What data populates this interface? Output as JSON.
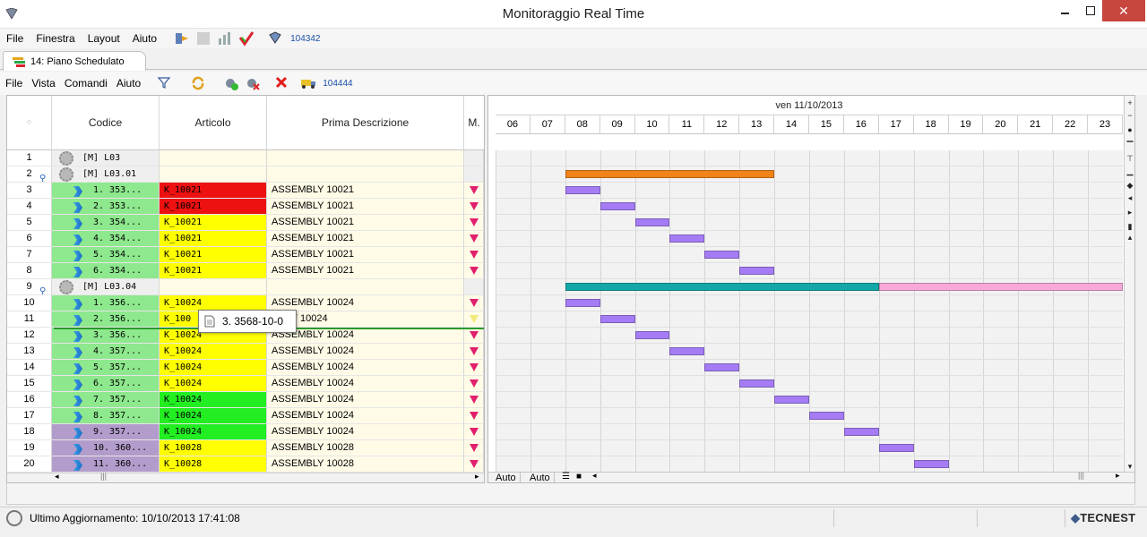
{
  "window": {
    "title": "Monitoraggio Real Time"
  },
  "main_menu": {
    "items": [
      "File",
      "Finestra",
      "Layout",
      "Aiuto"
    ],
    "counter": "104342"
  },
  "doc_tab": {
    "label": "14: Piano Schedulato"
  },
  "inner_menu": {
    "items": [
      "File",
      "Vista",
      "Comandi",
      "Aiuto"
    ],
    "counter": "104444"
  },
  "grid": {
    "headers": {
      "codice": "Codice",
      "articolo": "Articolo",
      "descrizione": "Prima Descrizione",
      "m": "M."
    },
    "rows": [
      {
        "n": "1",
        "kind": "group",
        "code": "[M] L03",
        "pin": false,
        "art": "",
        "desc": "",
        "m": ""
      },
      {
        "n": "2",
        "kind": "group",
        "code": "[M] L03.01",
        "pin": true,
        "art": "",
        "desc": "",
        "m": ""
      },
      {
        "n": "3",
        "kind": "item",
        "code": "1. 353...",
        "chip": "#8ee88e",
        "art": "K_10021",
        "art_color": "#ee1111",
        "desc": "ASSEMBLY 10021",
        "m": "down"
      },
      {
        "n": "4",
        "kind": "item",
        "code": "2. 353...",
        "chip": "#8ee88e",
        "art": "K_10021",
        "art_color": "#ee1111",
        "desc": "ASSEMBLY 10021",
        "m": "down"
      },
      {
        "n": "5",
        "kind": "item",
        "code": "3. 354...",
        "chip": "#8ee88e",
        "art": "K_10021",
        "art_color": "#ffff00",
        "desc": "ASSEMBLY 10021",
        "m": "down"
      },
      {
        "n": "6",
        "kind": "item",
        "code": "4. 354...",
        "chip": "#8ee88e",
        "art": "K_10021",
        "art_color": "#ffff00",
        "desc": "ASSEMBLY 10021",
        "m": "down"
      },
      {
        "n": "7",
        "kind": "item",
        "code": "5. 354...",
        "chip": "#8ee88e",
        "art": "K_10021",
        "art_color": "#ffff00",
        "desc": "ASSEMBLY 10021",
        "m": "down"
      },
      {
        "n": "8",
        "kind": "item",
        "code": "6. 354...",
        "chip": "#8ee88e",
        "art": "K_10021",
        "art_color": "#ffff00",
        "desc": "ASSEMBLY 10021",
        "m": "down"
      },
      {
        "n": "9",
        "kind": "group",
        "code": "[M] L03.04",
        "pin": true,
        "art": "",
        "desc": "",
        "m": ""
      },
      {
        "n": "10",
        "kind": "item",
        "code": "1. 356...",
        "chip": "#8ee88e",
        "art": "K_10024",
        "art_color": "#ffff00",
        "desc": "ASSEMBLY 10024",
        "m": "down"
      },
      {
        "n": "11",
        "kind": "item",
        "code": "2. 356...",
        "chip": "#8ee88e",
        "art": "K_100",
        "art_color": "#ffff00",
        "desc": "MBLY 10024",
        "m": "light"
      },
      {
        "n": "12",
        "kind": "item",
        "code": "3. 356...",
        "chip": "#8ee88e",
        "art": "K_10024",
        "art_color": "#ffff00",
        "desc": "ASSEMBLY 10024",
        "m": "down"
      },
      {
        "n": "13",
        "kind": "item",
        "code": "4. 357...",
        "chip": "#8ee88e",
        "art": "K_10024",
        "art_color": "#ffff00",
        "desc": "ASSEMBLY 10024",
        "m": "down"
      },
      {
        "n": "14",
        "kind": "item",
        "code": "5. 357...",
        "chip": "#8ee88e",
        "art": "K_10024",
        "art_color": "#ffff00",
        "desc": "ASSEMBLY 10024",
        "m": "down"
      },
      {
        "n": "15",
        "kind": "item",
        "code": "6. 357...",
        "chip": "#8ee88e",
        "art": "K_10024",
        "art_color": "#ffff00",
        "desc": "ASSEMBLY 10024",
        "m": "down"
      },
      {
        "n": "16",
        "kind": "item",
        "code": "7. 357...",
        "chip": "#8ee88e",
        "art": "K_10024",
        "art_color": "#22ee22",
        "desc": "ASSEMBLY 10024",
        "m": "down"
      },
      {
        "n": "17",
        "kind": "item",
        "code": "8. 357...",
        "chip": "#8ee88e",
        "art": "K_10024",
        "art_color": "#22ee22",
        "desc": "ASSEMBLY 10024",
        "m": "down"
      },
      {
        "n": "18",
        "kind": "item",
        "code": "9. 357...",
        "chip": "#b29ccb",
        "art": "K_10024",
        "art_color": "#22ee22",
        "desc": "ASSEMBLY 10024",
        "m": "down"
      },
      {
        "n": "19",
        "kind": "item",
        "code": "10. 360...",
        "chip": "#b29ccb",
        "art": "K_10028",
        "art_color": "#ffff00",
        "desc": "ASSEMBLY 10028",
        "m": "down"
      },
      {
        "n": "20",
        "kind": "item",
        "code": "11. 360...",
        "chip": "#b29ccb",
        "art": "K_10028",
        "art_color": "#ffff00",
        "desc": "ASSEMBLY 10028",
        "m": "down"
      }
    ]
  },
  "tooltip": {
    "text": "3. 3568-10-0"
  },
  "gantt": {
    "date": "ven 11/10/2013",
    "hours": [
      "06",
      "07",
      "08",
      "09",
      "10",
      "11",
      "12",
      "13",
      "14",
      "15",
      "16",
      "17",
      "18",
      "19",
      "20",
      "21",
      "22",
      "23"
    ],
    "bars": [
      {
        "row": 2,
        "start": 8,
        "end": 14,
        "color": "#f08418"
      },
      {
        "row": 3,
        "start": 8,
        "end": 9,
        "color": "#a57cf5"
      },
      {
        "row": 4,
        "start": 9,
        "end": 10,
        "color": "#a57cf5"
      },
      {
        "row": 5,
        "start": 10,
        "end": 11,
        "color": "#a57cf5"
      },
      {
        "row": 6,
        "start": 11,
        "end": 12,
        "color": "#a57cf5"
      },
      {
        "row": 7,
        "start": 12,
        "end": 13,
        "color": "#a57cf5"
      },
      {
        "row": 8,
        "start": 13,
        "end": 14,
        "color": "#a57cf5"
      },
      {
        "row": 9,
        "start": 8,
        "end": 17,
        "color": "#14a7a7"
      },
      {
        "row": 9,
        "start": 17,
        "end": 24,
        "color": "#f7a8d8"
      },
      {
        "row": 10,
        "start": 8,
        "end": 9,
        "color": "#a57cf5"
      },
      {
        "row": 11,
        "start": 9,
        "end": 10,
        "color": "#a57cf5"
      },
      {
        "row": 12,
        "start": 10,
        "end": 11,
        "color": "#a57cf5"
      },
      {
        "row": 13,
        "start": 11,
        "end": 12,
        "color": "#a57cf5"
      },
      {
        "row": 14,
        "start": 12,
        "end": 13,
        "color": "#a57cf5"
      },
      {
        "row": 15,
        "start": 13,
        "end": 14,
        "color": "#a57cf5"
      },
      {
        "row": 16,
        "start": 14,
        "end": 15,
        "color": "#a57cf5"
      },
      {
        "row": 17,
        "start": 15,
        "end": 16,
        "color": "#a57cf5"
      },
      {
        "row": 18,
        "start": 16,
        "end": 17,
        "color": "#a57cf5"
      },
      {
        "row": 19,
        "start": 17,
        "end": 18,
        "color": "#a57cf5"
      },
      {
        "row": 20,
        "start": 18,
        "end": 19,
        "color": "#a57cf5"
      }
    ],
    "footer": [
      "Auto",
      "Auto"
    ]
  },
  "status": {
    "message": "Ultimo Aggiornamento: 10/10/2013 17:41:08",
    "brand": "TECNEST"
  }
}
